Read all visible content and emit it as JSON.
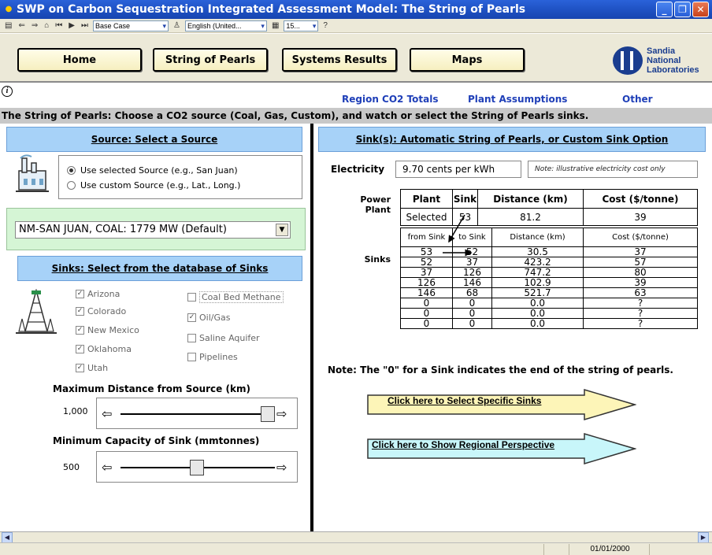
{
  "window": {
    "title": "SWP on Carbon Sequestration Integrated Assessment Model:  The String of Pearls"
  },
  "toolbar": {
    "view_select": "Base Case",
    "language_select": "English (United...",
    "zoom_select": "15..."
  },
  "nav": {
    "home": "Home",
    "string_of_pearls": "String of Pearls",
    "systems_results": "Systems Results",
    "maps": "Maps"
  },
  "logo": {
    "line1": "Sandia",
    "line2": "National",
    "line3": "Laboratories"
  },
  "links": {
    "region_totals": "Region CO2 Totals",
    "plant_assumptions": "Plant Assumptions",
    "other": "Other"
  },
  "instruction": "The String of Pearls:  Choose a CO2 source (Coal, Gas, Custom), and watch or select the String of Pearls sinks.",
  "source": {
    "header": "Source:  Select a Source",
    "option_selected": "Use selected Source (e.g., San Juan)",
    "option_custom": "Use custom Source (e.g., Lat., Long.)",
    "selected_value": "NM-SAN JUAN, COAL: 1779 MW (Default)"
  },
  "sinks_db": {
    "header": "Sinks:  Select from the database of Sinks",
    "states": [
      {
        "label": "Arizona",
        "checked": true
      },
      {
        "label": "Colorado",
        "checked": true
      },
      {
        "label": "New Mexico",
        "checked": true
      },
      {
        "label": "Oklahoma",
        "checked": true
      },
      {
        "label": "Utah",
        "checked": true
      }
    ],
    "types": [
      {
        "label": "Coal Bed Methane",
        "checked": false
      },
      {
        "label": "Oil/Gas",
        "checked": true
      },
      {
        "label": "Saline Aquifer",
        "checked": false
      },
      {
        "label": "Pipelines",
        "checked": false
      }
    ]
  },
  "max_distance": {
    "label": "Maximum Distance from Source (km)",
    "value": "1,000",
    "slider_fraction": 1.0
  },
  "min_capacity": {
    "label": "Minimum Capacity of Sink (mmtonnes)",
    "value": "500",
    "slider_fraction": 0.5
  },
  "right": {
    "header": "Sink(s):  Automatic String of Pearls, or Custom Sink Option",
    "electricity_label": "Electricity",
    "electricity_value": "9.70 cents per kWh",
    "electricity_note": "Note:  illustrative electricity cost only",
    "power_plant_label_1": "Power",
    "power_plant_label_2": "Plant",
    "sinks_label": "Sinks",
    "power_plant_table": {
      "headers": [
        "Plant",
        "Sink",
        "Distance (km)",
        "Cost ($/tonne)"
      ],
      "row": [
        "Selected",
        "53",
        "81.2",
        "39"
      ]
    },
    "sinks_table": {
      "headers": [
        "from Sink",
        "to Sink",
        "Distance (km)",
        "Cost ($/tonne)"
      ],
      "rows": [
        [
          "53",
          "52",
          "30.5",
          "37"
        ],
        [
          "52",
          "37",
          "423.2",
          "57"
        ],
        [
          "37",
          "126",
          "747.2",
          "80"
        ],
        [
          "126",
          "146",
          "102.9",
          "39"
        ],
        [
          "146",
          "68",
          "521.7",
          "63"
        ],
        [
          "0",
          "0",
          "0.0",
          "?"
        ],
        [
          "0",
          "0",
          "0.0",
          "?"
        ],
        [
          "0",
          "0",
          "0.0",
          "?"
        ]
      ]
    },
    "note": "Note:  The \"0\" for a Sink indicates the end of the string of pearls.",
    "select_sinks_button": "Click here to Select Specific Sinks",
    "regional_button": "Click here to Show Regional Perspective"
  },
  "status": {
    "date": "01/01/2000"
  },
  "colors": {
    "header_blue": "#a7d2f8",
    "link_blue": "#1f3fb8",
    "source_green": "#d5f5d5",
    "arrow_yellow": "#fdf5b8",
    "arrow_cyan": "#c8f6fa"
  }
}
